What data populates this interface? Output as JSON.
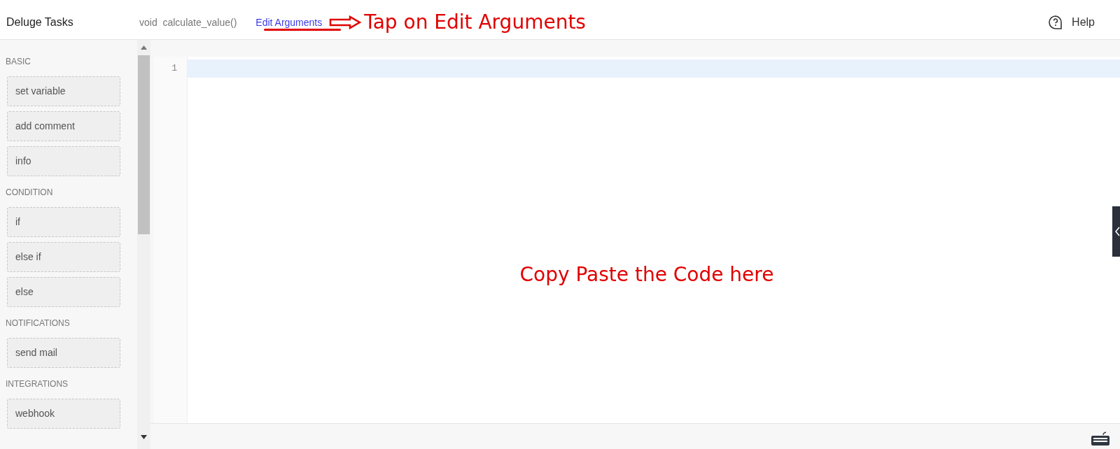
{
  "header": {
    "title": "Deluge Tasks",
    "function_name": "void  calculate_value()",
    "edit_link": "Edit Arguments",
    "help": "Help"
  },
  "annotations": {
    "header_note": "Tap on Edit Arguments",
    "editor_note": "Copy Paste the Code here"
  },
  "sidebar": {
    "sections": [
      {
        "heading": "BASIC",
        "items": [
          "set variable",
          "add comment",
          "info"
        ]
      },
      {
        "heading": "CONDITION",
        "items": [
          "if",
          "else if",
          "else"
        ]
      },
      {
        "heading": "NOTIFICATIONS",
        "items": [
          "send mail"
        ]
      },
      {
        "heading": "INTEGRATIONS",
        "items": [
          "webhook"
        ]
      }
    ]
  },
  "editor": {
    "line_numbers": [
      "1"
    ]
  }
}
